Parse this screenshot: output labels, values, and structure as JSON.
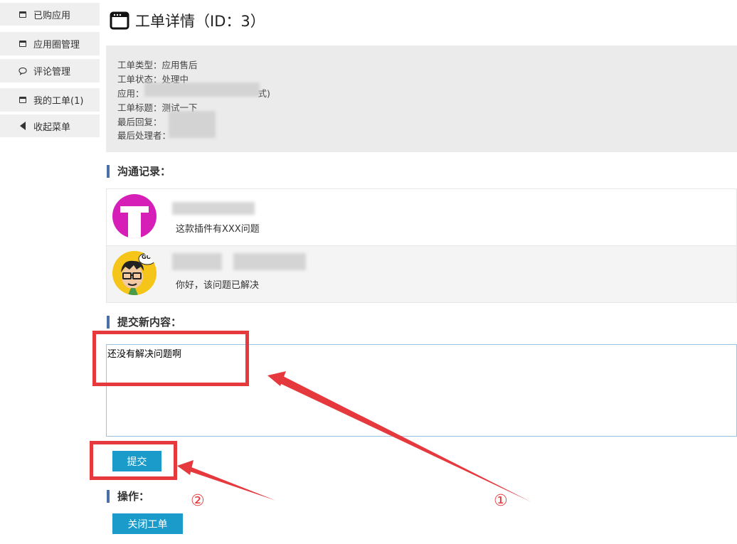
{
  "sidebar": {
    "items": [
      {
        "label": "已购应用",
        "icon": "window-icon"
      },
      {
        "label": "应用圈管理",
        "icon": "window-icon"
      },
      {
        "label": "评论管理",
        "icon": "comment-icon"
      },
      {
        "label": "我的工单(1)",
        "icon": "window-icon"
      },
      {
        "label": "收起菜单",
        "icon": "caret-left-icon"
      }
    ]
  },
  "page": {
    "title": "工单详情（ID：3）",
    "title_icon": "window-icon"
  },
  "info": {
    "type_label": "工单类型：应用售后",
    "status_label": "工单状态：处理中",
    "app_label": "应用：",
    "app_suffix": "式)",
    "subject_label": "工单标题：测试一下",
    "last_reply_label": "最后回复：",
    "last_handler_label": "最后处理者："
  },
  "communication": {
    "heading": "沟通记录：",
    "messages": [
      {
        "text": "这款插件有XXX问题",
        "avatar": "magenta-logo-avatar"
      },
      {
        "text": "你好，该问题已解决",
        "avatar": "cartoon-avatar",
        "avatar_badge": "GO"
      }
    ]
  },
  "submit_section": {
    "heading": "提交新内容：",
    "textarea_value": "还没有解决问题啊",
    "submit_label": "提交"
  },
  "actions": {
    "heading": "操作：",
    "close_label": "关闭工单"
  },
  "annotations": {
    "marker_1": "①",
    "marker_2": "②"
  },
  "colors": {
    "accent_button": "#1a9bc9",
    "annotation": "#e5393d",
    "section_bar": "#4a6fa5",
    "sidebar_bg": "#efefef",
    "panel_bg": "#ebebeb"
  }
}
